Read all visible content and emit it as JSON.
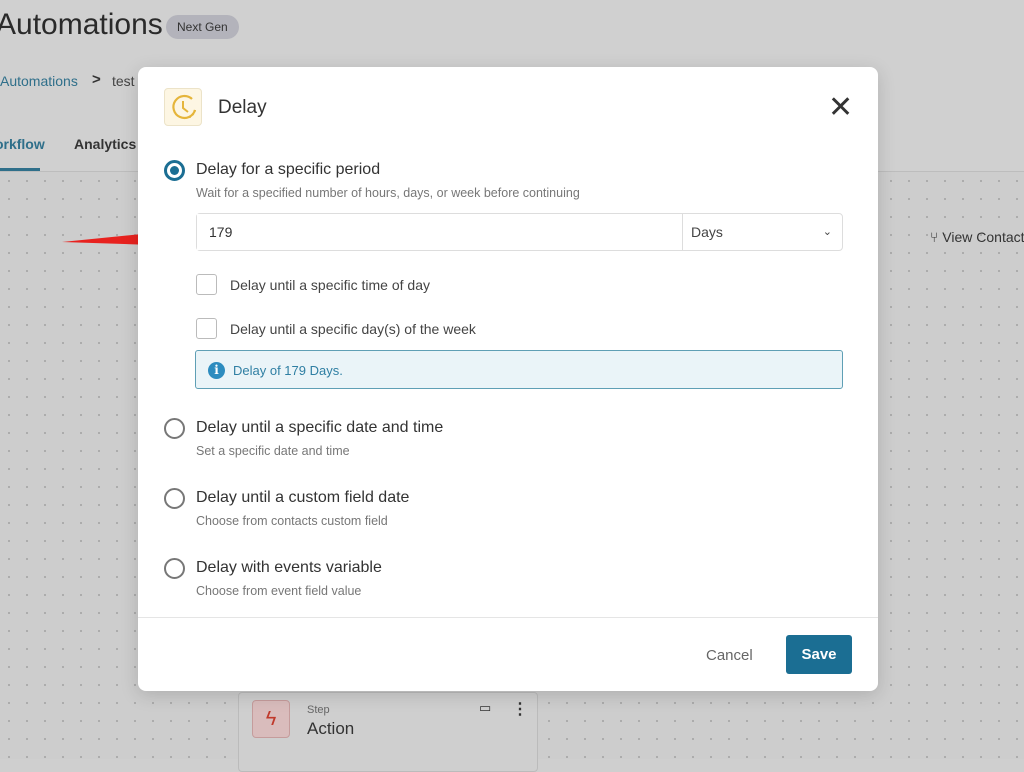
{
  "header": {
    "title": "Automations",
    "badge": "Next Gen",
    "breadcrumb": {
      "parent": "Automations",
      "separator": ">",
      "current": "test"
    },
    "tabs": [
      {
        "label": "Workflow",
        "active": true
      },
      {
        "label": "Analytics"
      }
    ]
  },
  "canvas": {
    "view_contacts": "View Contacts",
    "node": {
      "step_label": "Step",
      "name": "Action",
      "icon": "lightning-icon"
    }
  },
  "modal": {
    "title": "Delay",
    "icon": "clock-icon",
    "accent": "#1b6e93",
    "options": [
      {
        "label": "Delay for a specific period",
        "description": "Wait for a specified number of hours, days, or week before continuing",
        "selected": true
      },
      {
        "label": "Delay until a specific date and time",
        "description": "Set a specific date and time",
        "selected": false
      },
      {
        "label": "Delay until a custom field date",
        "description": "Choose from contacts custom field",
        "selected": false
      },
      {
        "label": "Delay with events variable",
        "description": "Choose from event field value",
        "selected": false
      }
    ],
    "period": {
      "value": "179",
      "unit": "Days"
    },
    "checkboxes": [
      {
        "label": "Delay until a specific time of day",
        "checked": false
      },
      {
        "label": "Delay until a specific day(s) of the week",
        "checked": false
      }
    ],
    "info": "Delay of 179 Days.",
    "cancel": "Cancel",
    "save": "Save"
  }
}
